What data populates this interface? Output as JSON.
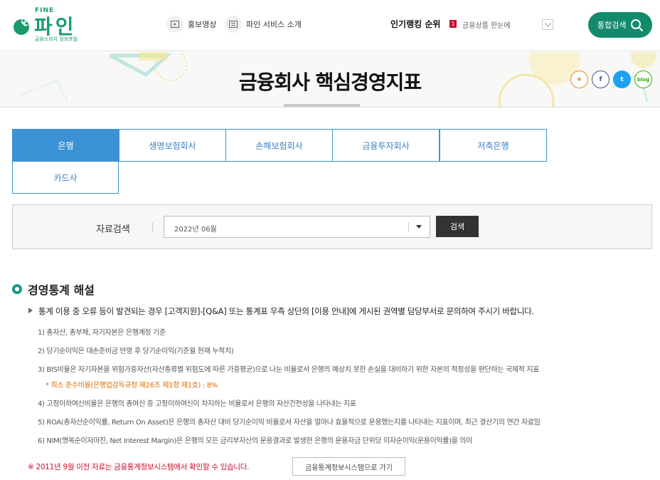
{
  "header": {
    "logo_fine": "FINE",
    "logo_text": "파인",
    "logo_sub": "금융소비자 정보포털",
    "links": [
      {
        "label": "홍보영상",
        "icon": "video-icon"
      },
      {
        "label": "파인 서비스 소개",
        "icon": "list-icon"
      }
    ],
    "ranking_title": "인기랭킹 순위",
    "ranking_num": "1",
    "ranking_item": "금융상품 한눈에",
    "search_label": "통합검색"
  },
  "banner": {
    "title": "금융회사 핵심경영지표",
    "sns": [
      "★",
      "f",
      "t",
      "blog"
    ]
  },
  "tabs": [
    {
      "label": "은행",
      "active": true
    },
    {
      "label": "생명보험회사"
    },
    {
      "label": "손해보험회사"
    },
    {
      "label": "금융투자회사"
    },
    {
      "label": "저축은행"
    },
    {
      "label": "카드사"
    }
  ],
  "filter": {
    "label": "자료검색",
    "selected": "2022년 06월",
    "button": "검색"
  },
  "section": {
    "title": "경영통계 해설",
    "notice": "통계 이용 중 오류 등이 발견되는 경우 [고객지원]-[Q&A] 또는 통계표 우측 상단의 [이용 안내]에 게시된 권역별 담당부서로 문의하여 주시기 바랍니다.",
    "items": [
      "1) 총자산, 총부채, 자기자본은 은행계정 기준",
      "2) 당기순이익은 대손준비금 반영 후 당기순이익(기준월 현재 누적치)",
      "3) BIS비율은 자기자본을 위험가중자산(자산종류별 위험도에 따른 가중평균)으로 나눈 비율로서 은행의 예상치 못한 손실을 대비하기 위한 자본의 적정성을 판단하는 국제적 지표",
      "* 최소 준수비율(은행업감독규정 제26조 제1항 제1호) : 8%",
      "4) 고정이하여신비율은 은행의 총여신 중 고정이하여신이 차지하는 비율로서 은행의 자산건전성을 나타내는 지표",
      "5) ROA(총자산순이익률, Return On Asset)은 은행의 총자산 대비 당기순이익 비율로서 자산을 얼마나 효율적으로 운용했는지를 나타내는 지표이며, 최근 결산기의 연간 자료임",
      "6) NIM(명목순이자마진, Net Interest Margin)은 은행의 모든 금리부자산의 운용결과로 발생한 은행의 운용자금 단위당 이자순이익(운용이익률)을 의미"
    ],
    "bottom_note": "※ 2011년 9월 이전 자료는 금융통계정보시스템에서 확인할 수 있습니다.",
    "bottom_button": "금융통계정보시스템으로 가기"
  }
}
